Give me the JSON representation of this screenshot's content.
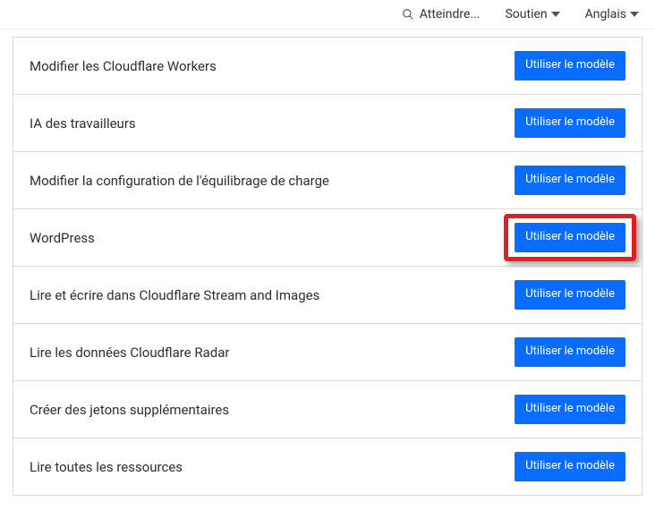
{
  "header": {
    "search_label": "Atteindre...",
    "support_label": "Soutien",
    "language_label": "Anglais"
  },
  "button_label": "Utiliser le modèle",
  "rows": [
    {
      "label": "Modifier les Cloudflare Workers"
    },
    {
      "label": "IA des travailleurs"
    },
    {
      "label": "Modifier la configuration de l'équilibrage de charge"
    },
    {
      "label": "WordPress",
      "highlighted": true
    },
    {
      "label": "Lire et écrire dans Cloudflare Stream and Images"
    },
    {
      "label": "Lire les données Cloudflare Radar"
    },
    {
      "label": "Créer des jetons supplémentaires"
    },
    {
      "label": "Lire toutes les ressources"
    }
  ]
}
